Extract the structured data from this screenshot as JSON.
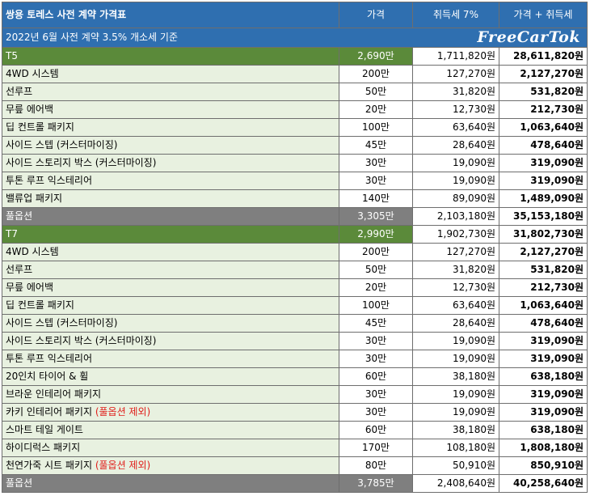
{
  "header": {
    "title": "쌍용 토레스 사전 계약 가격표",
    "col_price": "가격",
    "col_tax": "취득세 7%",
    "col_total": "가격 + 취득세"
  },
  "subheader": {
    "text": "2022년 6월 사전 계약 3.5% 개소세 기준",
    "logo": "FreeCarTok"
  },
  "rows": [
    {
      "type": "model",
      "name": "T5",
      "note": "",
      "price": "2,690만",
      "tax": "1,711,820원",
      "total": "28,611,820원"
    },
    {
      "type": "item",
      "name": "4WD 시스템",
      "note": "",
      "price": "200만",
      "tax": "127,270원",
      "total": "2,127,270원"
    },
    {
      "type": "item",
      "name": "선루프",
      "note": "",
      "price": "50만",
      "tax": "31,820원",
      "total": "531,820원"
    },
    {
      "type": "item",
      "name": "무릎 에어백",
      "note": "",
      "price": "20만",
      "tax": "12,730원",
      "total": "212,730원"
    },
    {
      "type": "item",
      "name": "딥 컨트롤 패키지",
      "note": "",
      "price": "100만",
      "tax": "63,640원",
      "total": "1,063,640원"
    },
    {
      "type": "item",
      "name": "사이드 스텝 (커스터마이징)",
      "note": "",
      "price": "45만",
      "tax": "28,640원",
      "total": "478,640원"
    },
    {
      "type": "item",
      "name": "사이드 스토리지 박스 (커스터마이징)",
      "note": "",
      "price": "30만",
      "tax": "19,090원",
      "total": "319,090원"
    },
    {
      "type": "item",
      "name": "투톤 루프 익스테리어",
      "note": "",
      "price": "30만",
      "tax": "19,090원",
      "total": "319,090원"
    },
    {
      "type": "item",
      "name": "밸류업 패키지",
      "note": "",
      "price": "140만",
      "tax": "89,090원",
      "total": "1,489,090원"
    },
    {
      "type": "full",
      "name": "풀옵션",
      "note": "",
      "price": "3,305만",
      "tax": "2,103,180원",
      "total": "35,153,180원"
    },
    {
      "type": "model",
      "name": "T7",
      "note": "",
      "price": "2,990만",
      "tax": "1,902,730원",
      "total": "31,802,730원"
    },
    {
      "type": "item",
      "name": "4WD 시스템",
      "note": "",
      "price": "200만",
      "tax": "127,270원",
      "total": "2,127,270원"
    },
    {
      "type": "item",
      "name": "선루프",
      "note": "",
      "price": "50만",
      "tax": "31,820원",
      "total": "531,820원"
    },
    {
      "type": "item",
      "name": "무릎 에어백",
      "note": "",
      "price": "20만",
      "tax": "12,730원",
      "total": "212,730원"
    },
    {
      "type": "item",
      "name": "딥 컨트롤 패키지",
      "note": "",
      "price": "100만",
      "tax": "63,640원",
      "total": "1,063,640원"
    },
    {
      "type": "item",
      "name": "사이드 스텝 (커스터마이징)",
      "note": "",
      "price": "45만",
      "tax": "28,640원",
      "total": "478,640원"
    },
    {
      "type": "item",
      "name": "사이드 스토리지 박스 (커스터마이징)",
      "note": "",
      "price": "30만",
      "tax": "19,090원",
      "total": "319,090원"
    },
    {
      "type": "item",
      "name": "투톤 루프 익스테리어",
      "note": "",
      "price": "30만",
      "tax": "19,090원",
      "total": "319,090원"
    },
    {
      "type": "item",
      "name": "20인치 타이어 & 휠",
      "note": "",
      "price": "60만",
      "tax": "38,180원",
      "total": "638,180원"
    },
    {
      "type": "item",
      "name": "브라운 인테리어 패키지",
      "note": "",
      "price": "30만",
      "tax": "19,090원",
      "total": "319,090원"
    },
    {
      "type": "item",
      "name": "카키 인테리어 패키지 ",
      "note": "(풀옵션 제외)",
      "price": "30만",
      "tax": "19,090원",
      "total": "319,090원"
    },
    {
      "type": "item",
      "name": "스마트 테일 게이트",
      "note": "",
      "price": "60만",
      "tax": "38,180원",
      "total": "638,180원"
    },
    {
      "type": "item",
      "name": "하이디럭스 패키지",
      "note": "",
      "price": "170만",
      "tax": "108,180원",
      "total": "1,808,180원"
    },
    {
      "type": "item",
      "name": "천연가죽 시트 패키지 ",
      "note": "(풀옵션 제외)",
      "price": "80만",
      "tax": "50,910원",
      "total": "850,910원"
    },
    {
      "type": "full",
      "name": "풀옵션",
      "note": "",
      "price": "3,785만",
      "tax": "2,408,640원",
      "total": "40,258,640원"
    }
  ],
  "colors": {
    "header_blue": "#2f6fb0",
    "model_green": "#5b8a3a",
    "item_green": "#e8f1e0",
    "full_gray": "#7f7f7f",
    "note_red": "#e0201c"
  }
}
